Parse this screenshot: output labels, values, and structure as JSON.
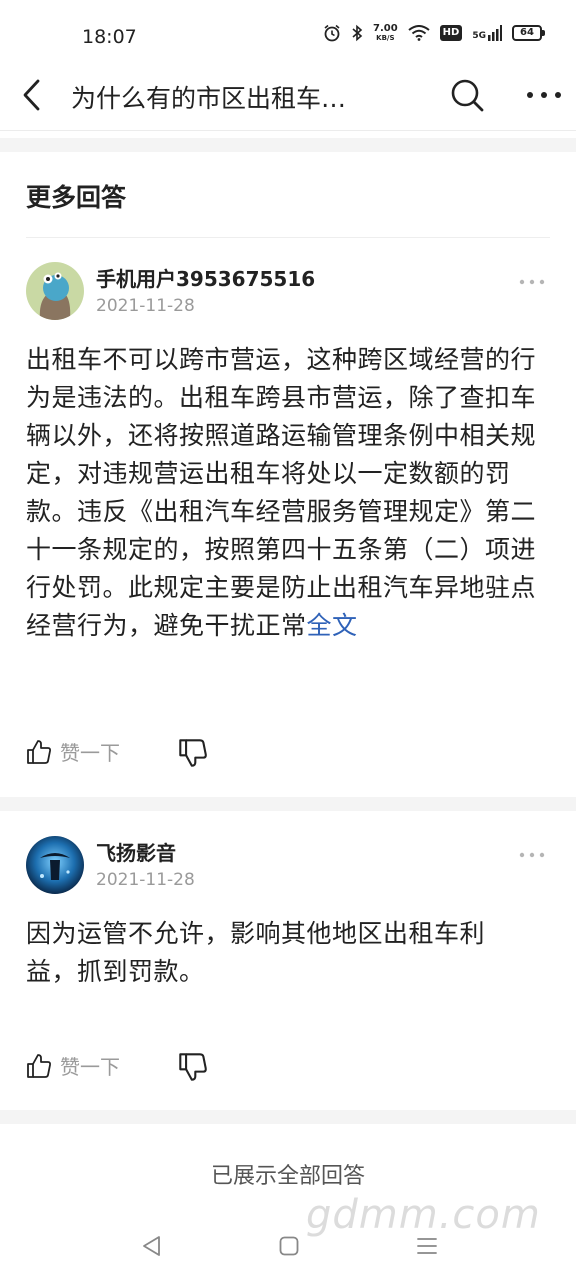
{
  "status_bar": {
    "time": "18:07",
    "net_speed_value": "7.00",
    "net_speed_unit": "KB/S",
    "hd": "HD",
    "signal_type": "5G",
    "battery": "64"
  },
  "header": {
    "title": "为什么有的市区出租车…",
    "icons": [
      "chevron-left-icon",
      "search-icon",
      "more-icon"
    ]
  },
  "section": {
    "title": "更多回答"
  },
  "answers": [
    {
      "user": "手机用户3953675516",
      "date": "2021-11-28",
      "text": "出租车不可以跨市营运，这种跨区域经营的行为是违法的。出租车跨县市营运，除了查扣车辆以外，还将按照道路运输管理条例中相关规定，对违规营运出租车将处以一定数额的罚款。违反《出租汽车经营服务管理规定》第二十一条规定的，按照第四十五条第（二）项进行处罚。此规定主要是防止出租汽车异地驻点经营行为，避免干扰正常",
      "read_more": "全文",
      "like_label": "赞一下"
    },
    {
      "user": "飞扬影音",
      "date": "2021-11-28",
      "text": "因为运管不允许，影响其他地区出租车利益，抓到罚款。",
      "like_label": "赞一下"
    }
  ],
  "footer": {
    "all_shown": "已展示全部回答"
  },
  "watermark": "gdmm.com",
  "colors": {
    "link": "#2f62b8",
    "muted": "#9a9a9a",
    "band": "#f4f4f4"
  }
}
